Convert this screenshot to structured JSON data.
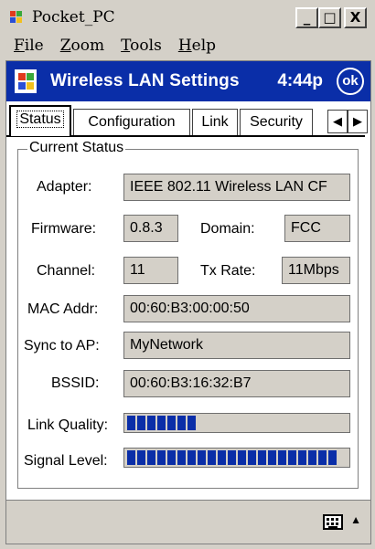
{
  "window": {
    "title": "Pocket_PC",
    "minimize_glyph": "_",
    "maximize_glyph": "□",
    "close_glyph": "X"
  },
  "menubar": {
    "items": [
      {
        "first": "F",
        "rest": "ile"
      },
      {
        "first": "Z",
        "rest": "oom"
      },
      {
        "first": "T",
        "rest": "ools"
      },
      {
        "first": "H",
        "rest": "elp"
      }
    ]
  },
  "navbar": {
    "title": "Wireless LAN Settings",
    "time": "4:44p",
    "ok_label": "ok"
  },
  "tabs": [
    {
      "label": "Status",
      "active": true
    },
    {
      "label": "Configuration",
      "active": false
    },
    {
      "label": "Link",
      "active": false
    },
    {
      "label": "Security",
      "active": false
    }
  ],
  "tab_arrows": {
    "left": "◀",
    "right": "▶"
  },
  "status": {
    "group_label": "Current Status",
    "adapter": {
      "label": "Adapter:",
      "value": "IEEE 802.11 Wireless LAN CF"
    },
    "firmware": {
      "label": "Firmware:",
      "value": "0.8.3"
    },
    "domain": {
      "label": "Domain:",
      "value": "FCC"
    },
    "channel": {
      "label": "Channel:",
      "value": "11"
    },
    "tx_rate": {
      "label": "Tx Rate:",
      "value": "11Mbps"
    },
    "mac_addr": {
      "label": "MAC Addr:",
      "value": "00:60:B3:00:00:50"
    },
    "sync_to_ap": {
      "label": "Sync to AP:",
      "value": "MyNetwork"
    },
    "bssid": {
      "label": "BSSID:",
      "value": "00:60:B3:16:32:B7"
    },
    "link_quality": {
      "label": "Link Quality:",
      "segments": 7,
      "max_segments": 21
    },
    "signal_level": {
      "label": "Signal Level:",
      "segments": 21,
      "max_segments": 21
    }
  },
  "colors": {
    "nav_blue": "#0a2ea8",
    "chrome_gray": "#d4d0c8"
  },
  "icons": {
    "app": "windows-flag-icon",
    "start": "start-menu-icon",
    "keyboard": "keyboard-icon",
    "sip_arrow": "up-arrow-icon"
  }
}
